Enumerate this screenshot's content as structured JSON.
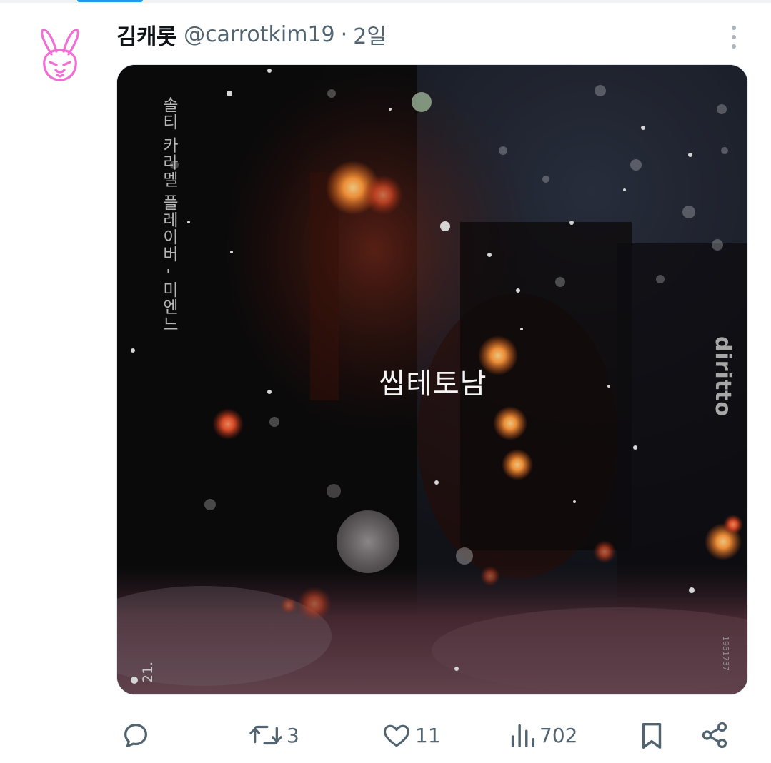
{
  "tweet": {
    "display_name": "김캐롯",
    "handle": "@carrotkim19",
    "separator": "·",
    "time": "2일",
    "media": {
      "album_title": "씹테토남",
      "side_text": "솔티 카라멜 플레이버 - 미엔느",
      "track_number": "21.",
      "label_logo": "diritto",
      "catalog_number": "1951737"
    },
    "actions": {
      "reply_count": "",
      "retweet_count": "3",
      "like_count": "11",
      "views_count": "702"
    },
    "icons": {
      "avatar": "pink-neon-bunny-avatar",
      "more": "more-vertical-icon",
      "reply": "reply-icon",
      "retweet": "retweet-icon",
      "like": "heart-icon",
      "views": "views-icon",
      "bookmark": "bookmark-icon",
      "share": "share-icon"
    }
  },
  "colors": {
    "text_primary": "#0f1419",
    "text_secondary": "#536471",
    "accent": "#1d9bf0",
    "avatar_neon": "#f06fd6"
  }
}
